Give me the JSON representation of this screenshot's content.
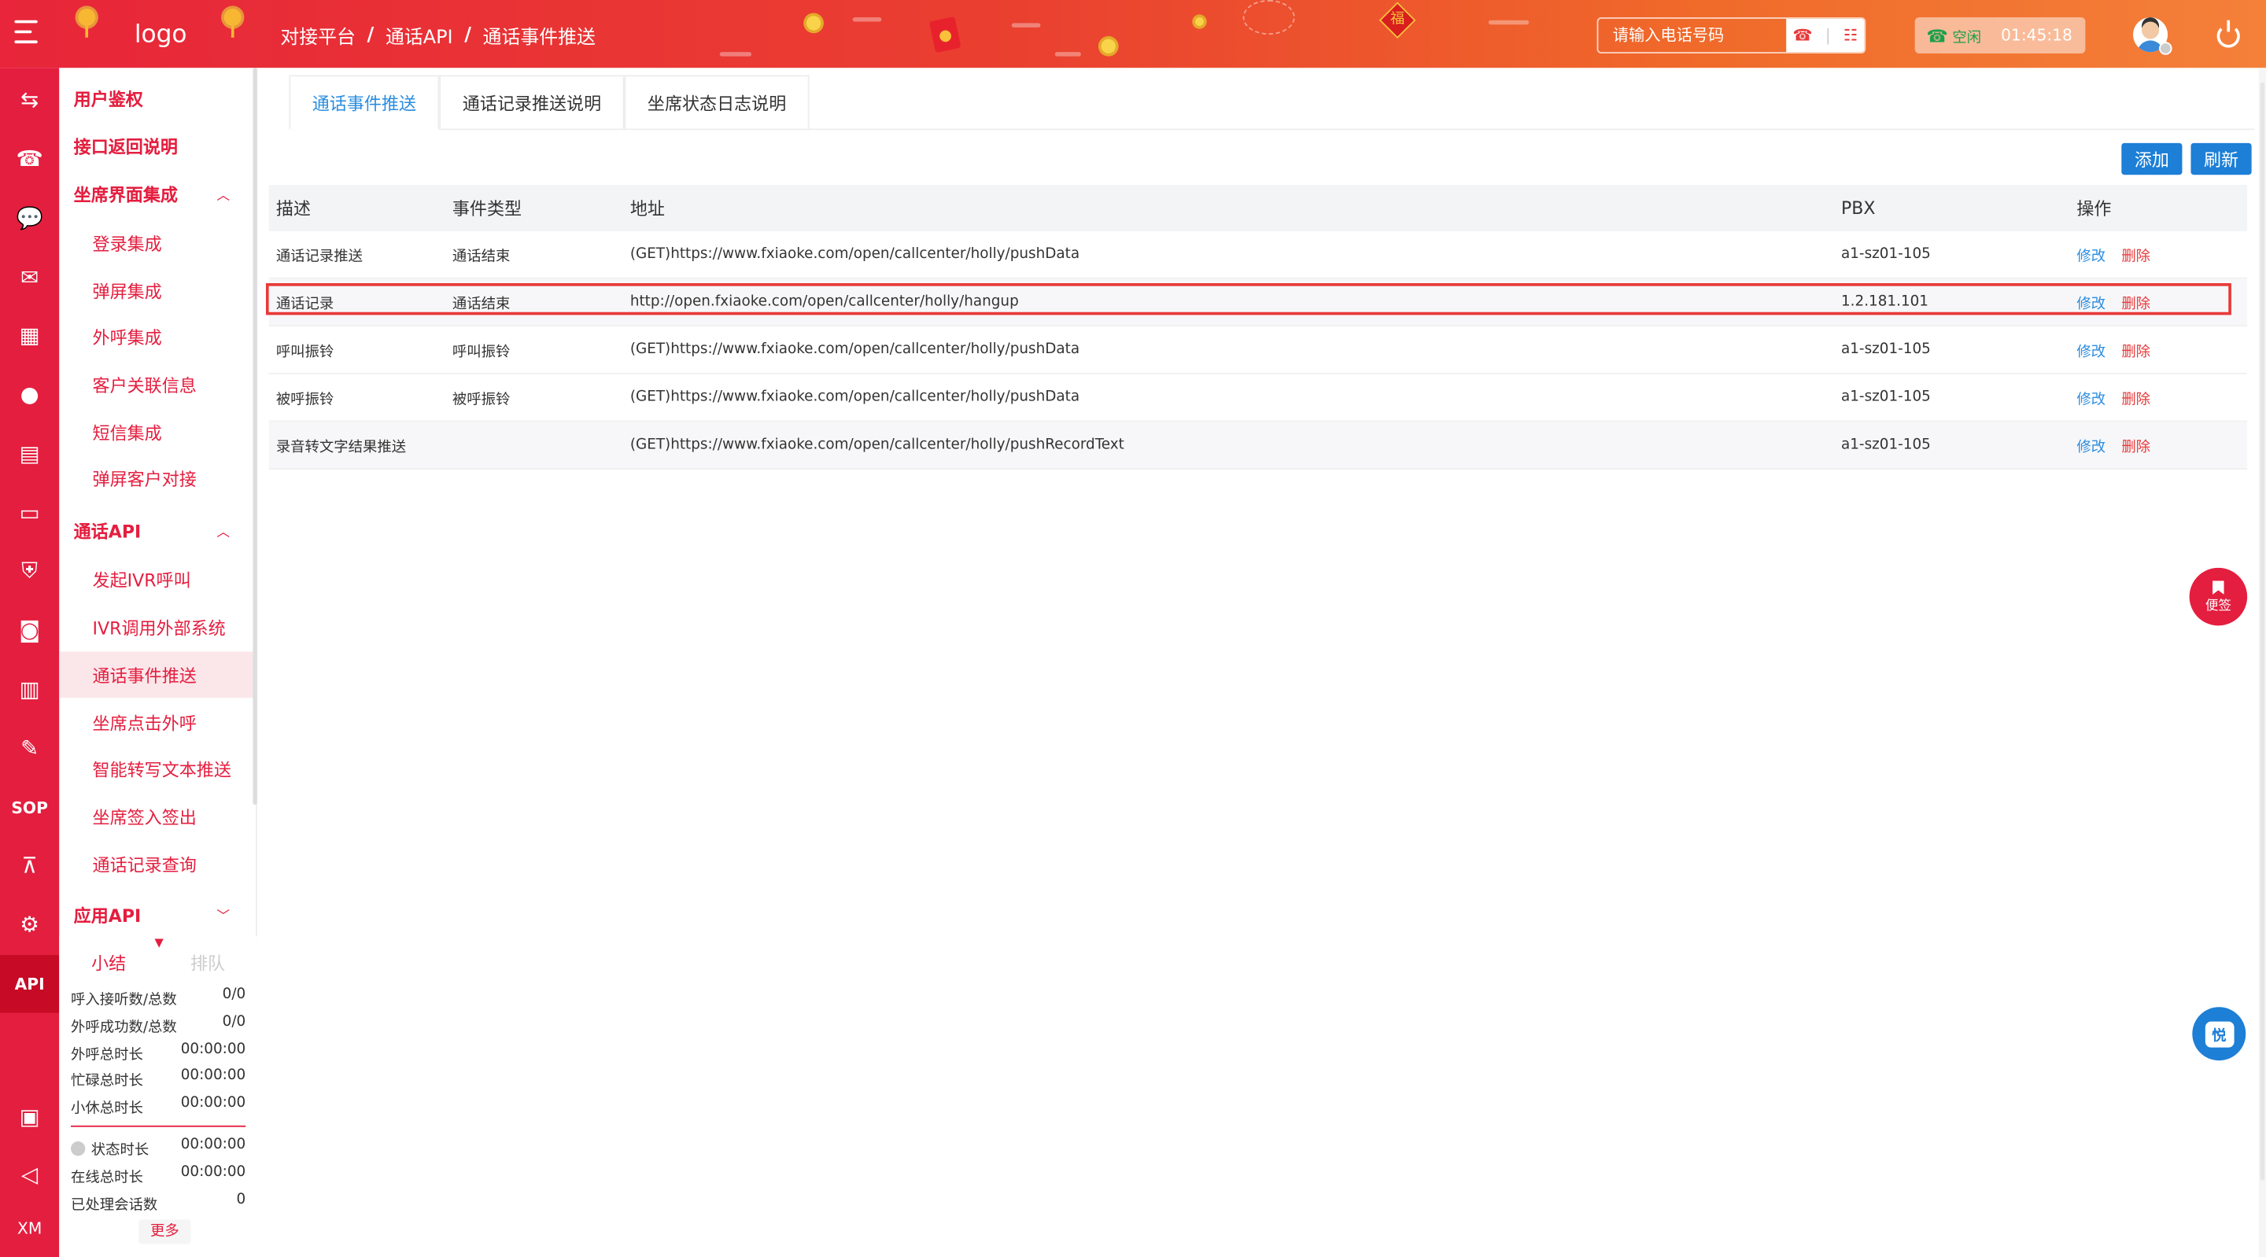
{
  "header": {
    "logo": "logo",
    "breadcrumb": [
      "对接平台",
      "通话API",
      "通话事件推送"
    ],
    "breadcrumb_sep": "/",
    "fu_char": "福",
    "search_placeholder": "请输入电话号码",
    "status_label": "空闲",
    "status_time": "01:45:18"
  },
  "iconbar": {
    "sop_label": "SOP",
    "api_label": "API",
    "xm_label": "XM",
    "icons": [
      "transfer-icon",
      "phone-icon",
      "chat-icon",
      "mail-icon",
      "grid-icon",
      "user-icon",
      "clipboard-icon",
      "monitor-icon",
      "shield-icon",
      "robot-icon",
      "bar-chart-icon",
      "message-icon",
      "sop-icon",
      "org-chart-icon",
      "gear-icon",
      "api-icon",
      "wechat-icon",
      "megaphone-icon",
      "xm-icon"
    ]
  },
  "sidebar": {
    "g1": "用户鉴权",
    "g2": "接口返回说明",
    "g3": "坐席界面集成",
    "g3_items": [
      "登录集成",
      "弹屏集成",
      "外呼集成",
      "客户关联信息",
      "短信集成",
      "弹屏客户对接"
    ],
    "g4": "通话API",
    "g4_items": [
      "发起IVR呼叫",
      "IVR调用外部系统",
      "通话事件推送",
      "坐席点击外呼",
      "智能转写文本推送",
      "坐席签入签出",
      "通话记录查询"
    ],
    "g5": "应用API"
  },
  "stats": {
    "tab1": "小结",
    "tab2": "排队",
    "rows": [
      {
        "label": "呼入接听数/总数",
        "value": "0/0"
      },
      {
        "label": "外呼成功数/总数",
        "value": "0/0"
      },
      {
        "label": "外呼总时长",
        "value": "00:00:00"
      },
      {
        "label": "忙碌总时长",
        "value": "00:00:00"
      },
      {
        "label": "小休总时长",
        "value": "00:00:00"
      }
    ],
    "rows2": [
      {
        "label": "状态时长",
        "value": "00:00:00"
      },
      {
        "label": "在线总时长",
        "value": "00:00:00"
      },
      {
        "label": "已处理会话数",
        "value": "0"
      }
    ],
    "more": "更多"
  },
  "tabs": [
    "通话事件推送",
    "通话记录推送说明",
    "坐席状态日志说明"
  ],
  "buttons": {
    "add": "添加",
    "refresh": "刷新"
  },
  "table": {
    "headers": [
      "描述",
      "事件类型",
      "地址",
      "PBX",
      "操作"
    ],
    "rows": [
      {
        "desc": "通话记录推送",
        "type": "通话结束",
        "url": "(GET)https://www.fxiaoke.com/open/callcenter/holly/pushData",
        "pbx": "a1-sz01-105",
        "edit": "修改",
        "del": "删除"
      },
      {
        "desc": "通话记录",
        "type": "通话结束",
        "url": "http://open.fxiaoke.com/open/callcenter/holly/hangup",
        "pbx": "1.2.181.101",
        "edit": "修改",
        "del": "删除"
      },
      {
        "desc": "呼叫振铃",
        "type": "呼叫振铃",
        "url": "(GET)https://www.fxiaoke.com/open/callcenter/holly/pushData",
        "pbx": "a1-sz01-105",
        "edit": "修改",
        "del": "删除"
      },
      {
        "desc": "被呼振铃",
        "type": "被呼振铃",
        "url": "(GET)https://www.fxiaoke.com/open/callcenter/holly/pushData",
        "pbx": "a1-sz01-105",
        "edit": "修改",
        "del": "删除"
      },
      {
        "desc": "录音转文字结果推送",
        "type": "",
        "url": "(GET)https://www.fxiaoke.com/open/callcenter/holly/pushRecordText",
        "pbx": "a1-sz01-105",
        "edit": "修改",
        "del": "删除"
      }
    ]
  },
  "fab": {
    "note": "便签",
    "chat": "悦"
  }
}
